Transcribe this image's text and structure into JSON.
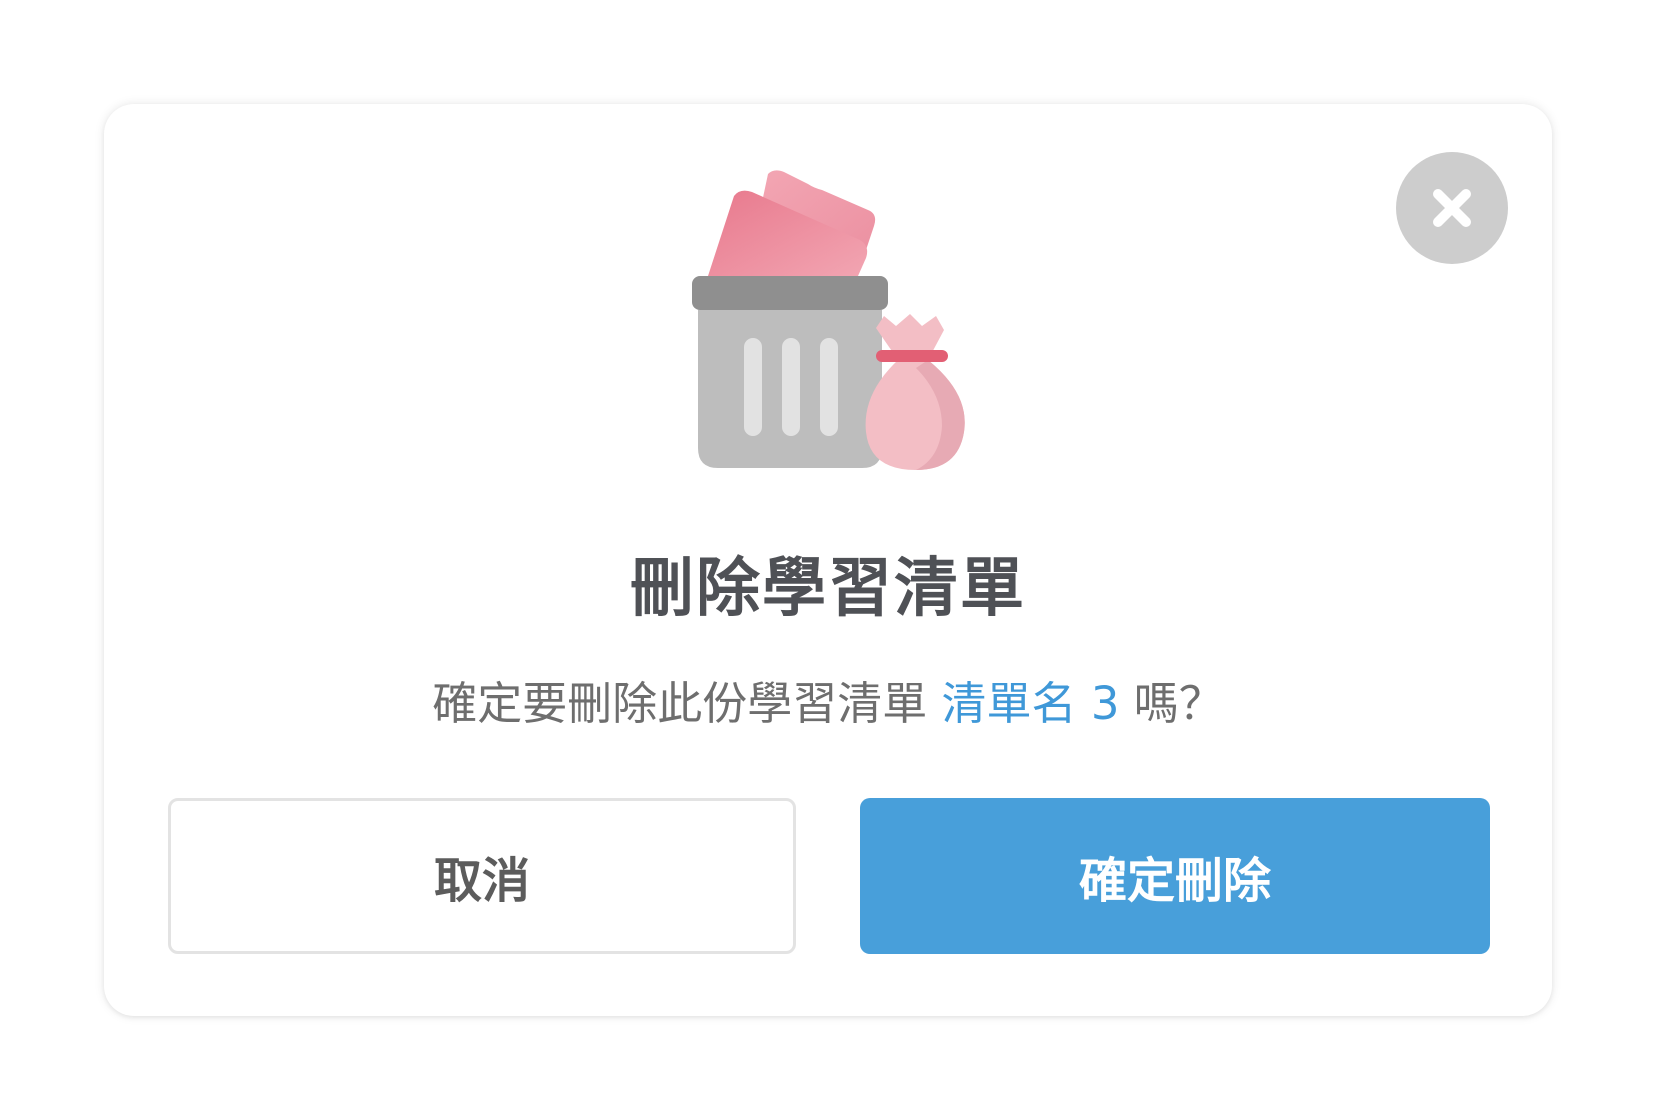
{
  "dialog": {
    "title": "刪除學習清單",
    "message_prefix": "確定要刪除此份學習清單",
    "list_name": "清單名 3",
    "message_suffix": "嗎？",
    "cancel_label": "取消",
    "confirm_label": "確定刪除",
    "illustration_icon": "trash-bin-icon",
    "close_icon": "close-icon"
  },
  "colors": {
    "primary": "#489fda",
    "highlight_text": "#3f98d8",
    "title_text": "#4f5156",
    "body_text": "#6e6e6e",
    "close_button_bg": "#cdcdcd"
  }
}
